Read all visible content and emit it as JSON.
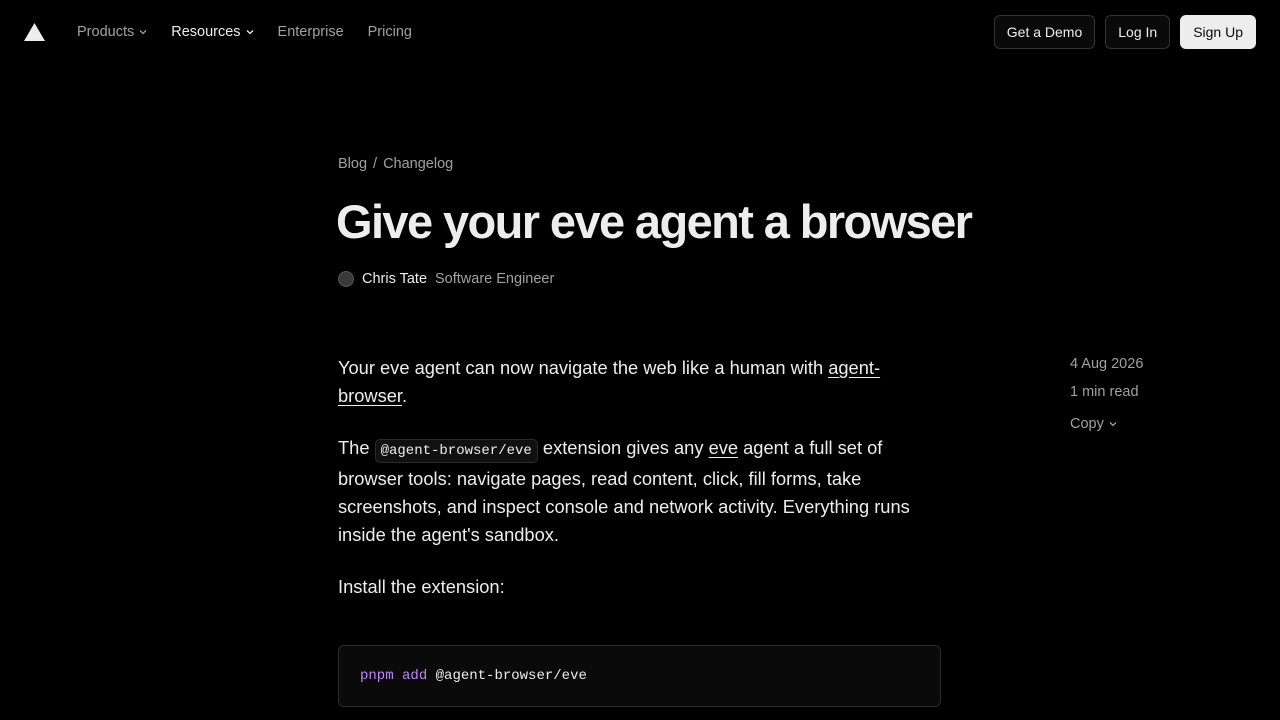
{
  "header": {
    "logo_icon": "triangle-logo-icon",
    "nav": [
      {
        "label": "Products",
        "has_menu": true
      },
      {
        "label": "Resources",
        "has_menu": true,
        "active": true
      },
      {
        "label": "Enterprise",
        "has_menu": false
      },
      {
        "label": "Pricing",
        "has_menu": false
      }
    ],
    "demo_label": "Get a Demo",
    "login_label": "Log In",
    "signup_label": "Sign Up"
  },
  "breadcrumb": {
    "root": "Blog",
    "sep": "/",
    "current": "Changelog"
  },
  "article": {
    "title": "Give your eve agent a browser",
    "author_name": "Chris Tate",
    "author_role": "Software Engineer",
    "p1_pre": "Your eve agent can now navigate the web like a human with ",
    "p1_link": "agent-browser",
    "p1_post": ".",
    "p2_pre": "The ",
    "p2_code": "@agent-browser/eve",
    "p2_mid": " extension gives any ",
    "p2_link": "eve",
    "p2_post": " agent a full set of browser tools: navigate pages, read content, click, fill forms, take screenshots, and inspect console and network activity. Everything runs inside the agent's sandbox.",
    "p3": "Install the extension:",
    "code_cmd": "pnpm",
    "code_sub": "add",
    "code_arg": "@agent-browser/eve"
  },
  "meta": {
    "date": "4 Aug 2026",
    "read_time": "1 min read",
    "copy_label": "Copy"
  },
  "colors": {
    "accent_code_keyword": "#c084fc",
    "background": "#000000"
  }
}
